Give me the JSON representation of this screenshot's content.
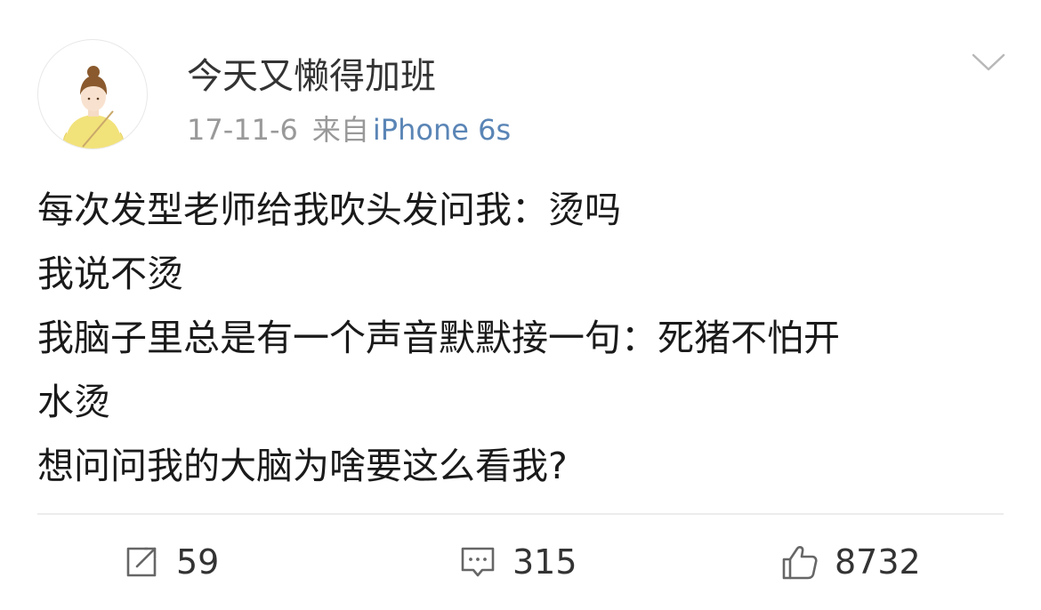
{
  "post": {
    "author": "今天又懒得加班",
    "date": "17-11-6",
    "source_prefix": "来自",
    "device": "iPhone 6s",
    "content_lines": [
      "每次发型老师给我吹头发问我：烫吗",
      "我说不烫",
      "我脑子里总是有一个声音默默接一句：死猪不怕开",
      "水烫",
      "想问问我的大脑为啥要这么看我?"
    ]
  },
  "actions": {
    "repost": {
      "icon": "repost-icon",
      "count": "59"
    },
    "comment": {
      "icon": "comment-icon",
      "count": "315"
    },
    "like": {
      "icon": "thumbs-up-icon",
      "count": "8732"
    }
  },
  "colors": {
    "text": "#1a1a1a",
    "meta": "#999999",
    "device_link": "#5a85b6",
    "divider": "#ececec"
  }
}
